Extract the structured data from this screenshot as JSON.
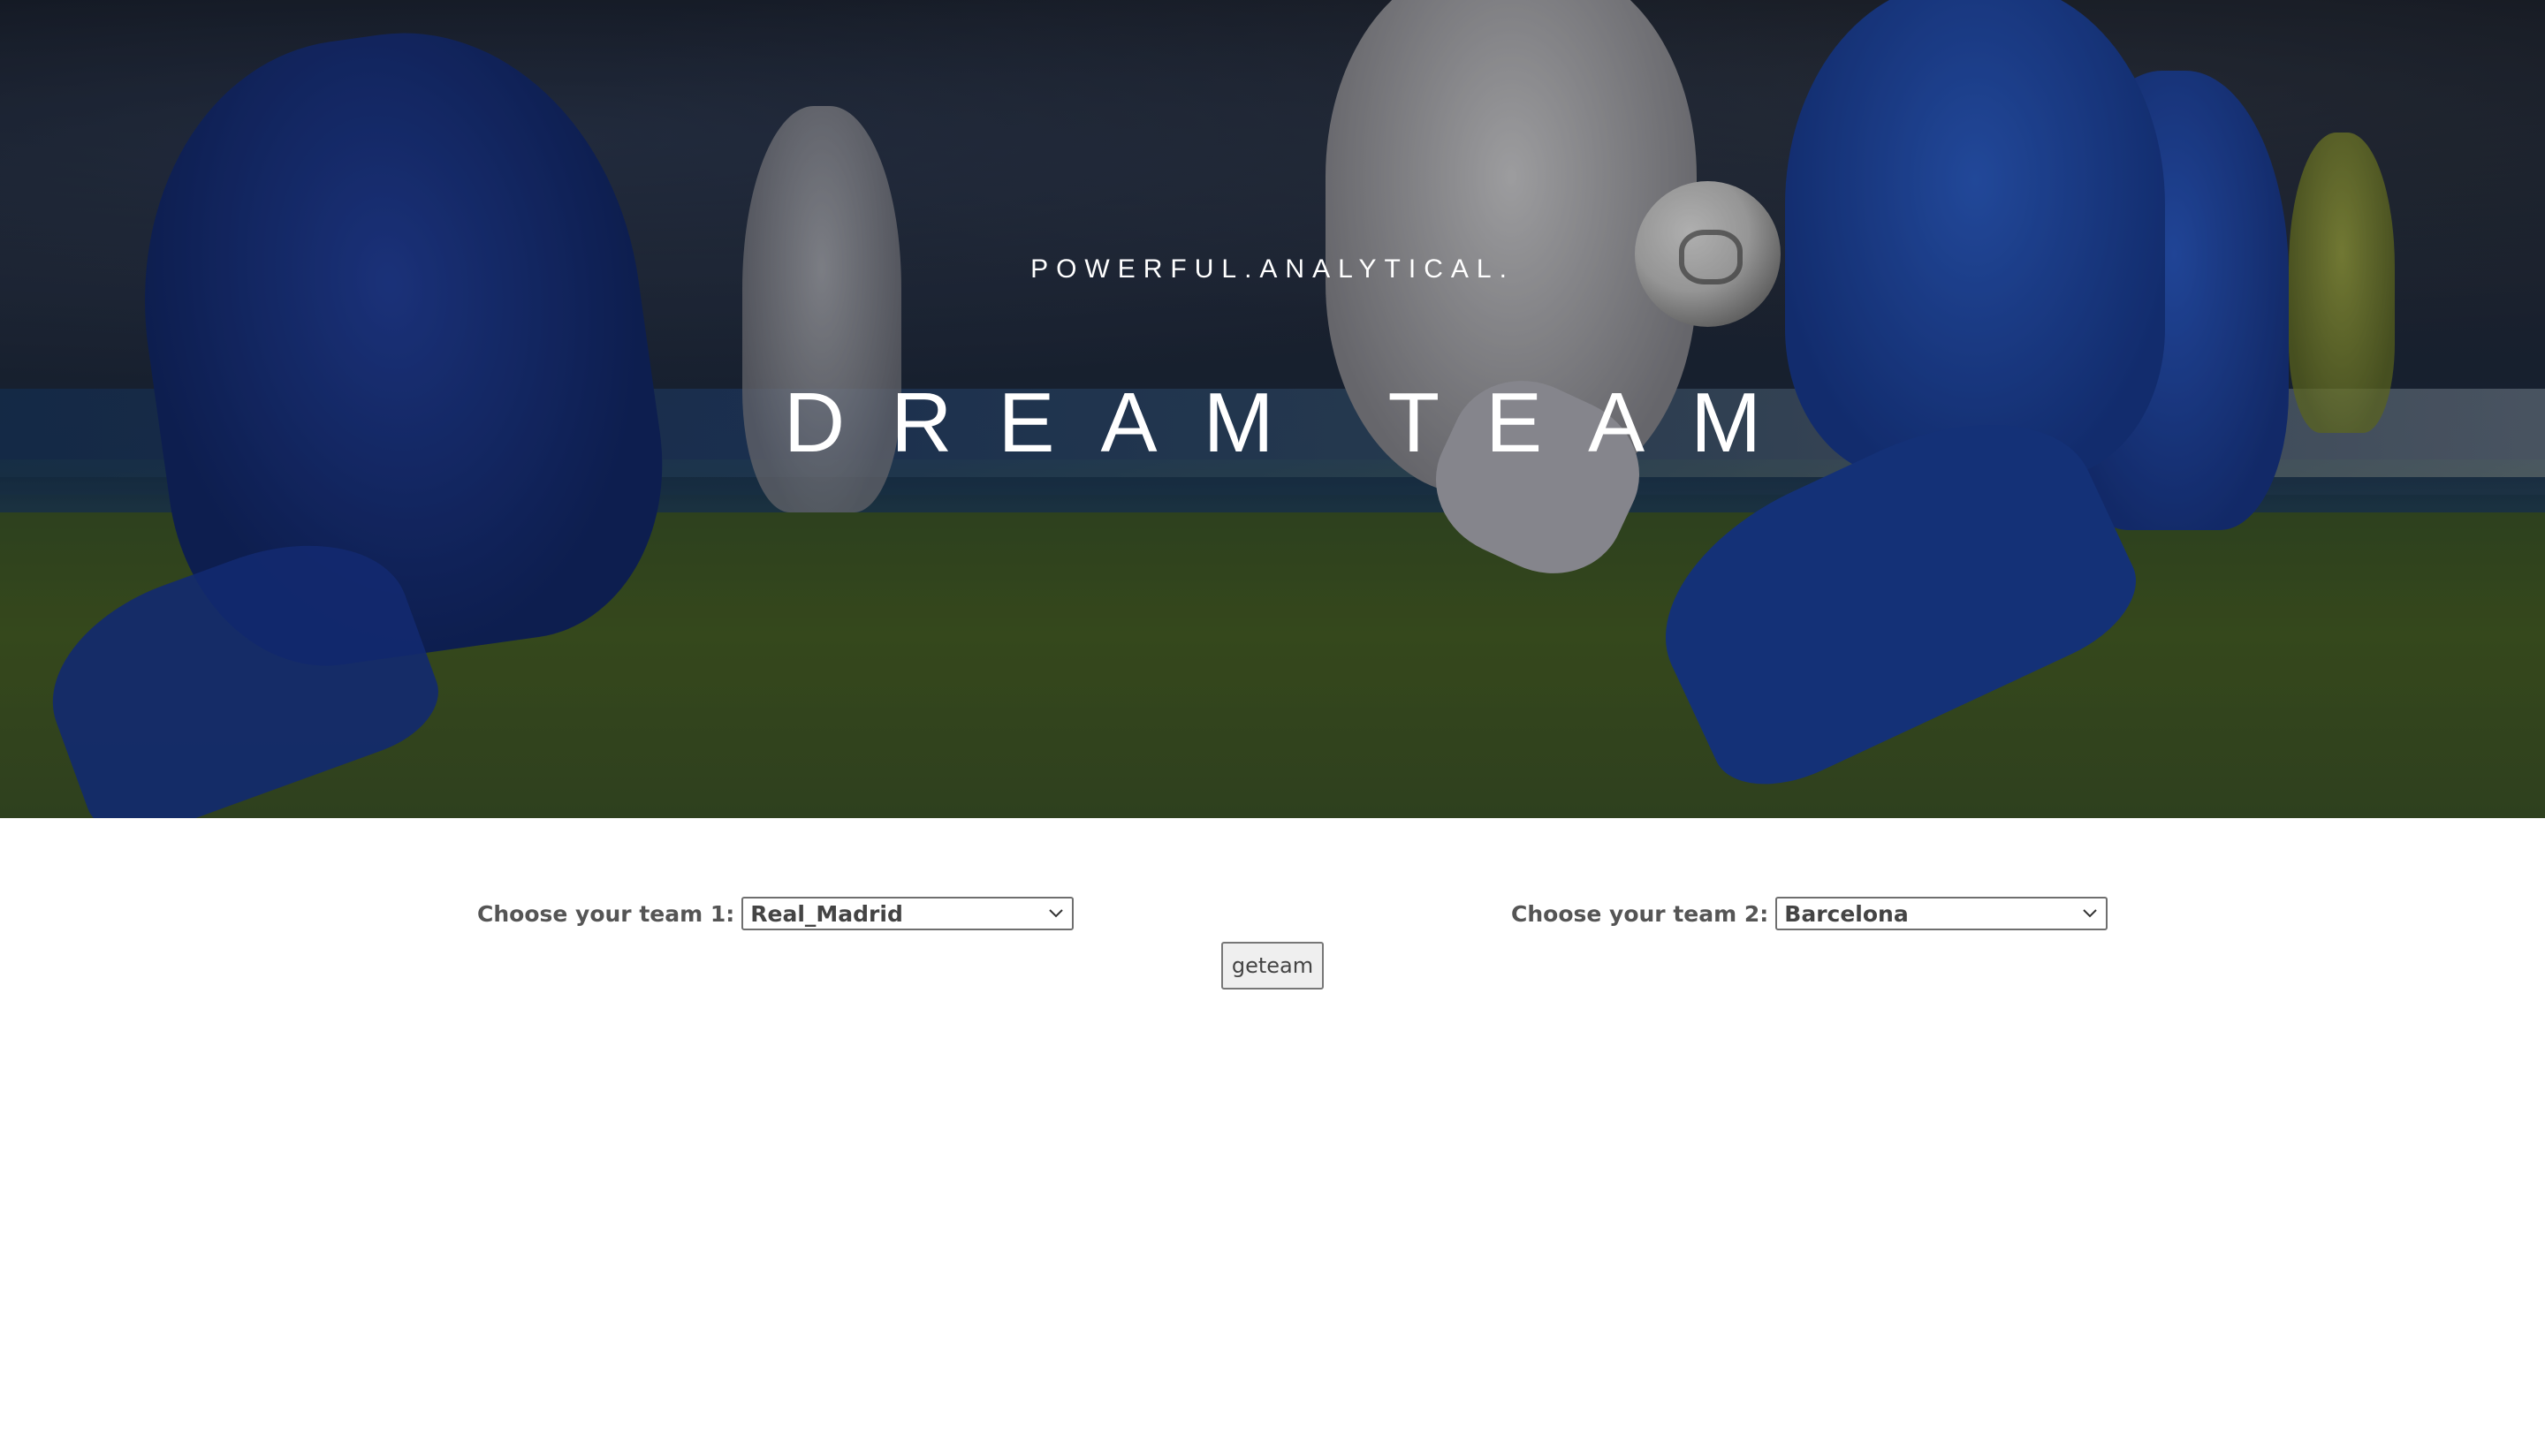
{
  "hero": {
    "tagline": "POWERFUL.ANALYTICAL.",
    "title": "DREAM TEAM"
  },
  "form": {
    "team1_label": "Choose your team 1:",
    "team1_selected": "Real_Madrid",
    "team2_label": "Choose your team 2:",
    "team2_selected": "Barcelona",
    "submit_label": "geteam"
  },
  "icons": {
    "dropdown": "chevron-down-icon"
  }
}
